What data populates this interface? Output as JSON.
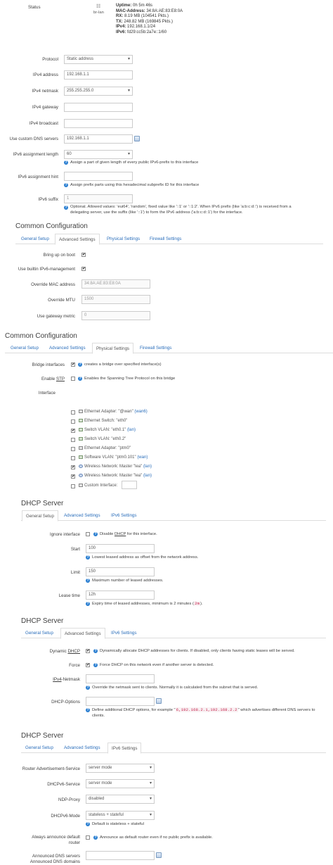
{
  "status": {
    "label": "Status",
    "device": "br-lan",
    "uptime_k": "Uptime:",
    "uptime_v": "0h 5m 46s",
    "mac_k": "MAC-Address:",
    "mac_v": "34:8A:AE:83:E8:0A",
    "rx_k": "RX:",
    "rx_v": "8.19 MB (104541 Pkts.)",
    "tx_k": "TX:",
    "tx_v": "248.82 MB (169845 Pkts.)",
    "ipv4_k": "IPv4:",
    "ipv4_v": "192.168.1.1/24",
    "ipv6_k": "IPv6:",
    "ipv6_v": "fd29:cc5b:2a7e::1/60"
  },
  "general": {
    "protocol_label": "Protocol",
    "protocol_value": "Static address",
    "ipaddr_label": "IPv4 address",
    "ipaddr_value": "192.168.1.1",
    "netmask_label": "IPv4 netmask",
    "netmask_value": "255.255.255.0",
    "gateway_label": "IPv4 gateway",
    "gateway_value": "",
    "broadcast_label": "IPv4 broadcast",
    "broadcast_value": "",
    "dns_label": "Use custom DNS servers",
    "dns_value": "192.168.1.1",
    "ip6assign_label": "IPv6 assignment length",
    "ip6assign_value": "60",
    "ip6assign_hint": "Assign a part of given length of every public IPv6-prefix to this interface",
    "ip6hint_label": "IPv6 assignment hint",
    "ip6hint_value": "",
    "ip6hint_hint": "Assign prefix parts using this hexadecimal subprefix ID for this interface",
    "ip6suffix_label": "IPv6 suffix",
    "ip6suffix_value": "1",
    "ip6suffix_hint": "Optional. Allowed values: 'eui64', 'random', fixed value like '::1' or '::1:2'. When IPv6 prefix (like 'a:b:c:d::') is received from a delegating server, use the suffix (like '::1') to form the IPv6 address ('a:b:c:d::1') for the interface."
  },
  "common1": {
    "title": "Common Configuration",
    "tabs": [
      "General Setup",
      "Advanced Settings",
      "Physical Settings",
      "Firewall Settings"
    ],
    "bringup_label": "Bring up on boot",
    "bringup_checked": true,
    "ipv6mgmt_label": "Use builtin IPv6-management",
    "ipv6mgmt_checked": true,
    "mac_label": "Override MAC address",
    "mac_placeholder": "34:8A:AE:83:E8:0A",
    "mtu_label": "Override MTU",
    "mtu_placeholder": "1500",
    "metric_label": "Use gateway metric",
    "metric_placeholder": "0"
  },
  "common2": {
    "title": "Common Configuration",
    "tabs": [
      "General Setup",
      "Advanced Settings",
      "Physical Settings",
      "Firewall Settings"
    ],
    "bridge_label": "Bridge interfaces",
    "bridge_checked": true,
    "bridge_hint": "creates a bridge over specified interface(s)",
    "stp_label_a": "Enable ",
    "stp_label_b": "STP",
    "stp_checked": false,
    "stp_hint": "Enables the Spanning Tree Protocol on this bridge",
    "iface_label": "Interface",
    "interfaces": [
      {
        "checked": false,
        "icon": "ethernet-icon",
        "text": "Ethernet Adapter: \"@wan\"",
        "net": "(wan6)"
      },
      {
        "checked": false,
        "icon": "switch-icon",
        "text": "Ethernet Switch: \"eth0\"",
        "net": ""
      },
      {
        "checked": true,
        "icon": "switch-icon",
        "text": "Switch VLAN: \"eth0.1\"",
        "net": "(lan)"
      },
      {
        "checked": false,
        "icon": "switch-icon",
        "text": "Switch VLAN: \"eth0.2\"",
        "net": ""
      },
      {
        "checked": false,
        "icon": "ethernet-icon",
        "text": "Ethernet Adapter: \"ptm0\"",
        "net": ""
      },
      {
        "checked": false,
        "icon": "software-icon",
        "text": "Software VLAN: \"ptm0.101\"",
        "net": "(wan)"
      },
      {
        "checked": true,
        "icon": "wireless-icon",
        "text": "Wireless Network: Master \"lea\"",
        "net": "(lan)"
      },
      {
        "checked": true,
        "icon": "wireless-icon",
        "text": "Wireless Network: Master \"lea\"",
        "net": "(lan)"
      },
      {
        "checked": false,
        "icon": "custom-icon",
        "text": "Custom Interface:",
        "net": ""
      }
    ]
  },
  "dhcp1": {
    "title": "DHCP Server",
    "tabs": [
      "General Setup",
      "Advanced Settings",
      "IPv6 Settings"
    ],
    "ignore_label": "Ignore interface",
    "ignore_checked": false,
    "ignore_hint_a": "Disable ",
    "ignore_hint_b": "DHCP",
    "ignore_hint_c": " for this interface.",
    "start_label": "Start",
    "start_value": "100",
    "start_hint": "Lowest leased address as offset from the network address.",
    "limit_label": "Limit",
    "limit_value": "150",
    "limit_hint": "Maximum number of leased addresses.",
    "lease_label": "Lease time",
    "lease_value": "12h",
    "lease_hint_a": "Expiry time of leased addresses, minimum is 2 minutes (",
    "lease_hint_code": "2m",
    "lease_hint_b": ")."
  },
  "dhcp2": {
    "title": "DHCP Server",
    "tabs": [
      "General Setup",
      "Advanced Settings",
      "IPv6 Settings"
    ],
    "dyn_label_a": "Dynamic ",
    "dyn_label_b": "DHCP",
    "dyn_checked": true,
    "dyn_hint": "Dynamically allocate DHCP addresses for clients. If disabled, only clients having static leases will be served.",
    "force_label": "Force",
    "force_checked": true,
    "force_hint": "Force DHCP on this network even if another server is detected.",
    "netmask_label_a": "IPv4",
    "netmask_label_b": "-Netmask",
    "netmask_value": "",
    "netmask_hint": "Override the netmask sent to clients. Normally it is calculated from the subnet that is served.",
    "options_label": "DHCP-Options",
    "options_value": "",
    "options_hint_a": "Define additional DHCP options, for example \"",
    "options_hint_code": "6,192.168.2.1,192.168.2.2",
    "options_hint_b": "\" which advertises different DNS servers to clients."
  },
  "dhcp3": {
    "title": "DHCP Server",
    "tabs": [
      "General Setup",
      "Advanced Settings",
      "IPv6 Settings"
    ],
    "ra_label": "Router Advertisement-Service",
    "ra_value": "server mode",
    "dhcpv6_label": "DHCPv6-Service",
    "dhcpv6_value": "server mode",
    "ndp_label": "NDP-Proxy",
    "ndp_value": "disabled",
    "mode_label": "DHCPv6-Mode",
    "mode_value": "stateless + stateful",
    "mode_hint": "Default is stateless + stateful",
    "router_label": "Always announce default router",
    "router_checked": false,
    "router_hint": "Announce as default router even if no public prefix is available.",
    "dns_label": "Announced DNS servers",
    "dns_value": "",
    "domains_label": "Announced DNS domains",
    "domains_value": ""
  },
  "colors": {
    "link": "#2a6ebb",
    "help": "#2b7fd1",
    "border": "#cccccc"
  }
}
